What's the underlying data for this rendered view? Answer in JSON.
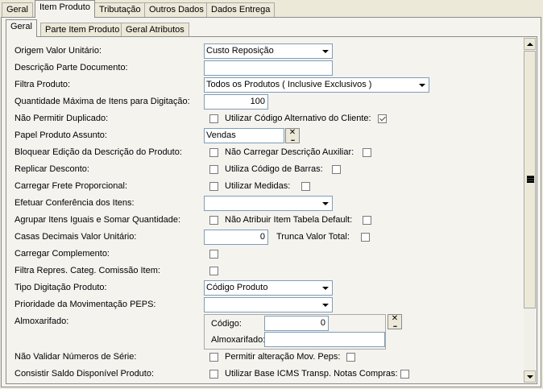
{
  "tabs": [
    "Geral",
    "Item Produto",
    "Tributação",
    "Outros Dados",
    "Dados Entrega"
  ],
  "subtabs": [
    "Geral",
    "Parte Item Produto",
    "Geral Atributos"
  ],
  "fields": {
    "origem_valor_unitario": {
      "label": "Origem Valor Unitário:",
      "value": "Custo Reposição"
    },
    "descricao_parte_documento": {
      "label": "Descrição Parte Documento:",
      "value": ""
    },
    "filtra_produto": {
      "label": "Filtra Produto:",
      "value": "Todos os Produtos ( Inclusive Exclusivos )"
    },
    "quantidade_maxima": {
      "label": "Quantidade Máxima de Itens para Digitação:",
      "value": "100"
    },
    "nao_permitir_duplicado": {
      "label": "Não Permitir Duplicado:"
    },
    "utilizar_codigo_alternativo": {
      "label": "Utilizar Código Alternativo do Cliente:"
    },
    "papel_produto_assunto": {
      "label": "Papel Produto Assunto:",
      "value": "Vendas"
    },
    "bloquear_edicao": {
      "label": "Bloquear Edição da Descrição do Produto:"
    },
    "nao_carregar_descricao": {
      "label": "Não Carregar Descrição Auxiliar:"
    },
    "replicar_desconto": {
      "label": "Replicar Desconto:"
    },
    "utiliza_codigo_barras": {
      "label": "Utiliza Código de Barras:"
    },
    "carregar_frete": {
      "label": "Carregar Frete Proporcional:"
    },
    "utilizar_medidas": {
      "label": "Utilizar Medidas:"
    },
    "efetuar_conferencia": {
      "label": "Efetuar Conferência dos Itens:",
      "value": ""
    },
    "agrupar_itens": {
      "label": "Agrupar Itens Iguais e Somar Quantidade:"
    },
    "nao_atribuir_item": {
      "label": "Não Atribuir Item Tabela Default:"
    },
    "casas_decimais": {
      "label": "Casas Decimais Valor Unitário:",
      "value": "0"
    },
    "trunca_valor_total": {
      "label": "Trunca Valor Total:"
    },
    "carregar_complemento": {
      "label": "Carregar Complemento:"
    },
    "filtra_repres": {
      "label": "Filtra Repres. Categ. Comissão Item:"
    },
    "tipo_digitacao": {
      "label": "Tipo Digitação Produto:",
      "value": "Código Produto"
    },
    "prioridade_peps": {
      "label": "Prioridade da Movimentação PEPS:",
      "value": ""
    },
    "almoxarifado": {
      "label": "Almoxarifado:",
      "codigo_label": "Código:",
      "codigo_value": "0",
      "almox_label": "Almoxarifado:",
      "almox_value": ""
    },
    "nao_validar_serie": {
      "label": "Não Validar Números de Série:"
    },
    "permitir_alteracao_peps": {
      "label": "Permitir alteração Mov. Peps:"
    },
    "consistir_saldo": {
      "label": "Consistir Saldo Disponível Produto:"
    },
    "utilizar_base_icms": {
      "label": "Utilizar Base ICMS Transp. Notas Compras:"
    }
  }
}
